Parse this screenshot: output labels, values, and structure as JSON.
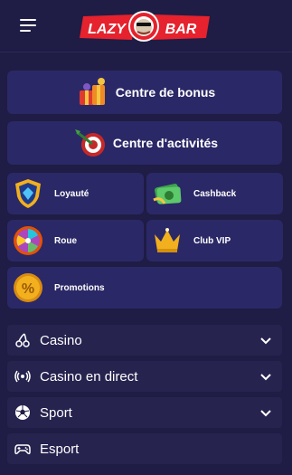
{
  "header": {
    "menu_icon": "hamburger-menu-icon",
    "logo_text_left": "LAZY",
    "logo_text_right": "BAR"
  },
  "cards": {
    "bonus": {
      "label": "Centre de bonus",
      "icon": "gift-boxes-icon"
    },
    "activities": {
      "label": "Centre d'activités",
      "icon": "dart-target-icon"
    },
    "loyalty": {
      "label": "Loyauté",
      "icon": "shield-diamond-icon"
    },
    "cashback": {
      "label": "Cashback",
      "icon": "cash-icon"
    },
    "wheel": {
      "label": "Roue",
      "icon": "fortune-wheel-icon"
    },
    "vip": {
      "label": "Club VIP",
      "icon": "crown-icon"
    },
    "promotions": {
      "label": "Promotions",
      "icon": "percent-coin-icon"
    }
  },
  "nav": [
    {
      "label": "Casino",
      "icon": "cherries-icon",
      "expandable": true
    },
    {
      "label": "Casino en direct",
      "icon": "live-broadcast-icon",
      "expandable": true
    },
    {
      "label": "Sport",
      "icon": "soccer-ball-icon",
      "expandable": true
    },
    {
      "label": "Esport",
      "icon": "gamepad-icon",
      "expandable": false
    }
  ],
  "colors": {
    "background": "#1f1c45",
    "card": "#2b2867",
    "nav_row": "#26234f",
    "logo_red": "#e5222d"
  }
}
